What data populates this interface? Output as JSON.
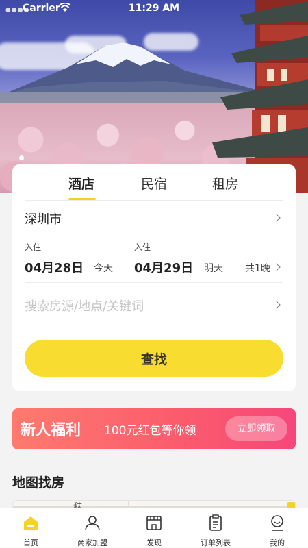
{
  "status_bar": {
    "carrier": "Carrier",
    "time": "11:29 AM"
  },
  "search_card": {
    "tabs": [
      {
        "label": "酒店",
        "active": true
      },
      {
        "label": "民宿",
        "active": false
      },
      {
        "label": "租房",
        "active": false
      }
    ],
    "city": "深圳市",
    "check_in": {
      "label": "入住",
      "date": "04月28日",
      "day": "今天"
    },
    "check_out": {
      "label": "入住",
      "date": "04月29日",
      "day": "明天"
    },
    "nights": "共1晚",
    "search_placeholder": "搜索房源/地点/关键词",
    "search_button": "查找"
  },
  "promo": {
    "title": "新人福利",
    "subtitle": "100元红包等你领",
    "button": "立即领取"
  },
  "map_section": {
    "title": "地图找房",
    "peek_text": "秣"
  },
  "tabbar": {
    "items": [
      {
        "label": "首页",
        "icon": "home-icon",
        "active": true
      },
      {
        "label": "商家加盟",
        "icon": "person-icon",
        "active": false
      },
      {
        "label": "发现",
        "icon": "store-icon",
        "active": false
      },
      {
        "label": "订单列表",
        "icon": "clipboard-icon",
        "active": false
      },
      {
        "label": "我的",
        "icon": "user-circle-icon",
        "active": false
      }
    ]
  },
  "colors": {
    "accent_yellow": "#f9dc30",
    "promo_red": "#fb5b6d"
  }
}
